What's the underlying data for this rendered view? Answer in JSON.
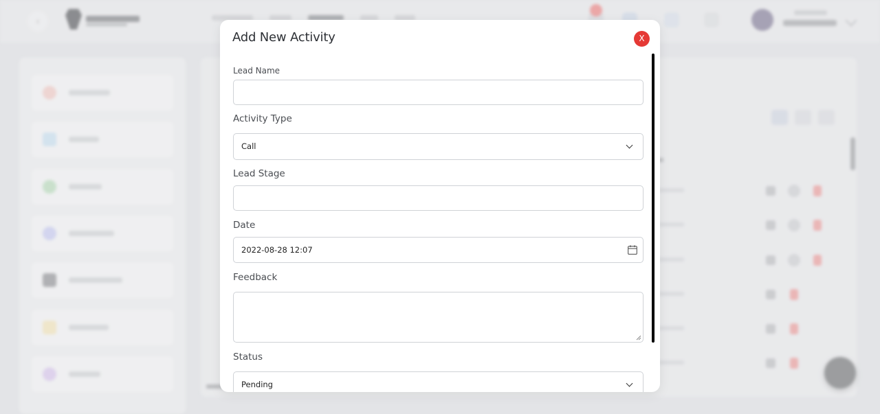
{
  "modal": {
    "title": "Add New Activity",
    "close_label": "X",
    "fields": {
      "lead_name": {
        "label": "Lead Name",
        "value": ""
      },
      "activity_type": {
        "label": "Activity Type",
        "value": "Call"
      },
      "lead_stage": {
        "label": "Lead Stage",
        "value": ""
      },
      "date": {
        "label": "Date",
        "value": "2022-08-28 12:07"
      },
      "feedback": {
        "label": "Feedback",
        "value": ""
      },
      "status": {
        "label": "Status",
        "value": "Pending"
      }
    }
  },
  "colors": {
    "close_button": "#e53935",
    "delete_icon": "#e79797",
    "overlay_background": "#dcdee2"
  },
  "icons": {
    "close": "close-icon",
    "dropdown": "chevron-down-icon",
    "calendar": "calendar-icon",
    "resize": "resize-handle-icon"
  }
}
